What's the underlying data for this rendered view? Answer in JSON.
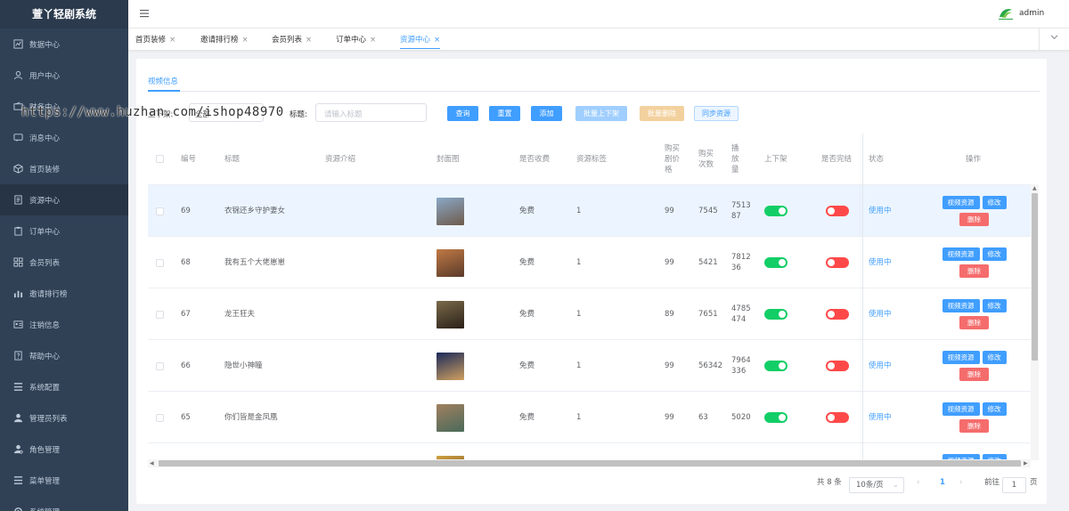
{
  "app": {
    "title": "萱丫轻剧系统",
    "user": "admin"
  },
  "sidebar": {
    "items": [
      {
        "label": "数据中心",
        "icon": "chart-icon"
      },
      {
        "label": "用户中心",
        "icon": "user-icon"
      },
      {
        "label": "财务中心",
        "icon": "wallet-icon"
      },
      {
        "label": "消息中心",
        "icon": "message-icon"
      },
      {
        "label": "首页装修",
        "icon": "cube-icon"
      },
      {
        "label": "资源中心",
        "icon": "document-icon"
      },
      {
        "label": "订单中心",
        "icon": "clipboard-icon"
      },
      {
        "label": "会员列表",
        "icon": "grid-icon"
      },
      {
        "label": "邀请排行榜",
        "icon": "bar-chart-icon"
      },
      {
        "label": "注销信息",
        "icon": "id-card-icon"
      },
      {
        "label": "帮助中心",
        "icon": "help-icon"
      },
      {
        "label": "系统配置",
        "icon": "list-icon"
      },
      {
        "label": "管理员列表",
        "icon": "person-icon"
      },
      {
        "label": "角色管理",
        "icon": "role-icon"
      },
      {
        "label": "菜单管理",
        "icon": "menu-icon"
      },
      {
        "label": "系统管理",
        "icon": "settings-icon"
      }
    ],
    "active_index": 5
  },
  "tabs": [
    {
      "label": "首页装修",
      "close": "×"
    },
    {
      "label": "邀请排行榜",
      "close": "×"
    },
    {
      "label": "会员列表",
      "close": "×"
    },
    {
      "label": "订单中心",
      "close": "×"
    },
    {
      "label": "资源中心",
      "close": "×",
      "active": true
    }
  ],
  "page": {
    "subtab": "视频信息",
    "filters": {
      "shelf_label": "上下架:",
      "shelf_value": "全部",
      "title_label": "标题:",
      "title_placeholder": "请输入标题"
    },
    "buttons": {
      "query": "查询",
      "reset": "重置",
      "add": "添加",
      "batch_shelf": "批量上下架",
      "batch_delete": "批量删除",
      "sync": "同步资源"
    },
    "watermark": "https://www.huzhan.com/ishop48970"
  },
  "table": {
    "headers": {
      "id": "编号",
      "title": "标题",
      "intro": "资源介绍",
      "cover": "封面图",
      "charge": "是否收费",
      "tag": "资源标签",
      "price": "购买剧价格",
      "buy_count": "购买次数",
      "plays": "播放量",
      "shelf": "上下架",
      "finished": "是否完结",
      "status": "状态",
      "ops": "操作"
    },
    "rows": [
      {
        "id": "69",
        "title": "衣锦还乡守护妻女",
        "intro": "",
        "charge": "免费",
        "tag": "1",
        "price": "99",
        "buy_count": "7545",
        "plays": "751387",
        "shelf_on": true,
        "finished_on": false,
        "status": "使用中",
        "cover_colors": [
          "#8ba8c8",
          "#6d5a4a"
        ]
      },
      {
        "id": "68",
        "title": "我有五个大佬崽崽",
        "intro": "",
        "charge": "免费",
        "tag": "1",
        "price": "99",
        "buy_count": "5421",
        "plays": "781236",
        "shelf_on": true,
        "finished_on": false,
        "status": "使用中",
        "cover_colors": [
          "#c07a45",
          "#5a3a2a"
        ]
      },
      {
        "id": "67",
        "title": "龙王狂夫",
        "intro": "",
        "charge": "免费",
        "tag": "1",
        "price": "89",
        "buy_count": "7651",
        "plays": "4785474",
        "shelf_on": true,
        "finished_on": false,
        "status": "使用中",
        "cover_colors": [
          "#7a6a4a",
          "#2a2018"
        ]
      },
      {
        "id": "66",
        "title": "隐世小神瞳",
        "intro": "",
        "charge": "免费",
        "tag": "1",
        "price": "99",
        "buy_count": "56342",
        "plays": "7964336",
        "shelf_on": true,
        "finished_on": false,
        "status": "使用中",
        "cover_colors": [
          "#1a2a5a",
          "#d0a060"
        ]
      },
      {
        "id": "65",
        "title": "你们皆是金凤凰",
        "intro": "",
        "charge": "免费",
        "tag": "1",
        "price": "99",
        "buy_count": "63",
        "plays": "5020",
        "shelf_on": true,
        "finished_on": false,
        "status": "使用中",
        "cover_colors": [
          "#a08060",
          "#4a6a5a"
        ]
      },
      {
        "id": "",
        "title": "",
        "intro": "",
        "charge": "",
        "tag": "",
        "price": "",
        "buy_count": "",
        "plays": "",
        "shelf_on": null,
        "finished_on": null,
        "status": "",
        "cover_colors": [
          "#d0a040",
          "#6a4a2a"
        ]
      }
    ],
    "op_labels": {
      "video": "视频资源",
      "edit": "修改",
      "delete": "删除"
    }
  },
  "pagination": {
    "total": "共 8 条",
    "page_size": "10条/页",
    "prev": "‹",
    "current": "1",
    "next": "›",
    "goto_label": "前往",
    "goto_value": "1",
    "page_suffix": "页"
  },
  "colors": {
    "sidebar_bg": "#304156",
    "accent": "#409eff",
    "switch_on": "#13ce66",
    "switch_off": "#ff4949",
    "delete": "#f56c6c"
  }
}
